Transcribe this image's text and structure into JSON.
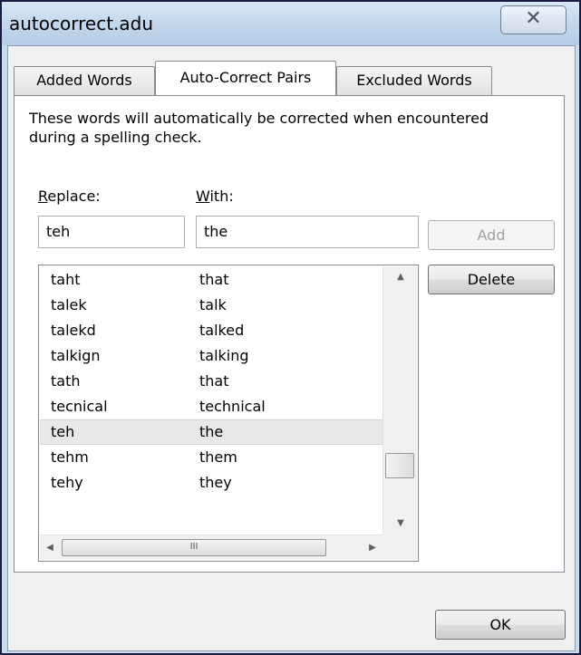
{
  "window": {
    "title": "autocorrect.adu",
    "close_glyph": "✕"
  },
  "tabs": [
    {
      "label": "Added Words"
    },
    {
      "label": "Auto-Correct Pairs"
    },
    {
      "label": "Excluded Words"
    }
  ],
  "description": "These words will automatically be corrected when encountered during a spelling check.",
  "replace": {
    "label_mnemonic": "R",
    "label_rest": "eplace:",
    "value": "teh"
  },
  "with": {
    "label_mnemonic": "W",
    "label_rest": "ith:",
    "value": "the"
  },
  "buttons": {
    "add": "Add",
    "delete": "Delete",
    "ok": "OK"
  },
  "list": {
    "rows": [
      {
        "misspelled": "taht",
        "correct": "that"
      },
      {
        "misspelled": "talek",
        "correct": "talk"
      },
      {
        "misspelled": "talekd",
        "correct": "talked"
      },
      {
        "misspelled": "talkign",
        "correct": "talking"
      },
      {
        "misspelled": "tath",
        "correct": "that"
      },
      {
        "misspelled": "tecnical",
        "correct": "technical"
      },
      {
        "misspelled": "teh",
        "correct": "the"
      },
      {
        "misspelled": "tehm",
        "correct": "them"
      },
      {
        "misspelled": "tehy",
        "correct": "they"
      }
    ],
    "selected_row": "teh",
    "hthumb_grip": "III"
  }
}
